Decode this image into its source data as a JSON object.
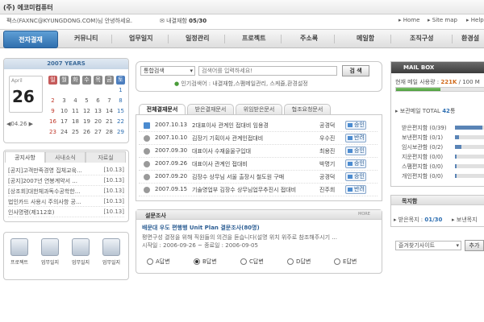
{
  "header": {
    "company": "(주) 에코미컴퓨터",
    "welcome": "팩스(FAXNC@KYUNGDONG.COM)님 안녕하세요.",
    "message_label": "내결재함",
    "message_count": "05/30",
    "links": [
      "Home",
      "Site map",
      "Help"
    ]
  },
  "nav": {
    "active": "전자결재",
    "items": [
      "커뮤니티",
      "업무일지",
      "일정관리",
      "프로젝트",
      "주소록",
      "메일함",
      "조직구성",
      "환경설"
    ]
  },
  "calendar": {
    "title": "2007 YEARS",
    "month": "April",
    "day": "26",
    "nav_label": "◀04.26 ▶",
    "weekdays": [
      "일",
      "월",
      "화",
      "수",
      "목",
      "금",
      "토"
    ],
    "rows": [
      [
        "",
        "",
        "",
        "",
        "",
        "",
        "1"
      ],
      [
        "2",
        "3",
        "4",
        "5",
        "6",
        "7",
        "8"
      ],
      [
        "9",
        "10",
        "11",
        "12",
        "13",
        "14",
        "15"
      ],
      [
        "16",
        "17",
        "18",
        "19",
        "20",
        "21",
        "22"
      ],
      [
        "23",
        "24",
        "25",
        "26",
        "27",
        "28",
        "29"
      ]
    ]
  },
  "notices": {
    "tabs": [
      "공지사항",
      "사내소식",
      "자료실"
    ],
    "items": [
      {
        "title": "[공지]고객만족경영 집체교육...",
        "date": "[10.13]"
      },
      {
        "title": "[공지]2007년 연봉계약서 ...",
        "date": "[10.13]"
      },
      {
        "title": "[상조회]대한체과독수공학한...",
        "date": "[10.13]"
      },
      {
        "title": "법인카드 사용시 주의사항 공...",
        "date": "[10.13]"
      },
      {
        "title": "인사명령(제112호)",
        "date": "[10.13]"
      }
    ]
  },
  "quick": [
    "프로젝트",
    "업무일지",
    "업무일지",
    "업무일지"
  ],
  "search": {
    "select": "통합검색",
    "placeholder": "검색어를 입력하세요!",
    "button": "검 색",
    "popular": "인기검색어 : 내결재함,스팸메일관리, 스케쥴,환경설정"
  },
  "doc_tabs": [
    "전체결재문서",
    "받은결재문서",
    "위임받은문서",
    "협조요청문서"
  ],
  "docs": [
    {
      "date": "2007.10.13",
      "title": "2대표이사 관계인 접대비 임용경",
      "name": "공경덕",
      "status": "승인",
      "checked": true
    },
    {
      "date": "2007.10.10",
      "title": "김장기 기획이사 관계인접대비",
      "name": "우수진",
      "status": "반려",
      "checked": false
    },
    {
      "date": "2007.09.30",
      "title": "대표이사 수재을울구입대",
      "name": "최용진",
      "status": "승인",
      "checked": false
    },
    {
      "date": "2007.09.26",
      "title": "대표이사 관계인 접대비",
      "name": "박명기",
      "status": "승인",
      "checked": false
    },
    {
      "date": "2007.09.20",
      "title": "김장수 상무님 서울 출장시 철도원 구매",
      "name": "공경덕",
      "status": "승인",
      "checked": false
    },
    {
      "date": "2007.09.15",
      "title": "기술영업부 김장수 상무님업무추진시 접대비",
      "name": "진주희",
      "status": "반려",
      "checked": false
    }
  ],
  "survey": {
    "title": "설문조사",
    "more": "MORE",
    "question": "배문대 우도 편행행 Unit Plan 결문조사(80명)",
    "desc": "평면구성 결정을 위해 직원들의 의견을 듣습니다(설명 위치 위주로 참조해주시기 ...",
    "period": "시작일 : 2006-09-26 ~ 종료일 : 2006-09-05",
    "options": [
      "A답변",
      "B답변",
      "C답변",
      "D답변",
      "E답변"
    ],
    "selected_index": 1
  },
  "mail": {
    "title": "MAIL BOX",
    "usage_label": "현재 메일 사용량 :",
    "usage_value": "221K",
    "usage_max": "/ 100 M",
    "usage_fraction": 0.5,
    "total_label": "보관메일 TOTAL",
    "total_value": "42",
    "total_unit": "통",
    "folders": [
      {
        "name": "받은편지함 (0/39)",
        "fraction": 0.85
      },
      {
        "name": "보낸편지함 (0/1)",
        "fraction": 0.12
      },
      {
        "name": "임시보관함 (0/2)",
        "fraction": 0.2
      },
      {
        "name": "지운편지함 (0/0)",
        "fraction": 0.05
      },
      {
        "name": "스팸편지함 (0/0)",
        "fraction": 0.05
      },
      {
        "name": "개인편지함 (0/0)",
        "fraction": 0.05
      }
    ]
  },
  "todo": {
    "title": "목지함",
    "received_label": "받은목지",
    "received_value": "01/30",
    "sent_label": "보낸목지"
  },
  "favorites": {
    "select": "즐겨찾기사이트",
    "button": "추가"
  }
}
